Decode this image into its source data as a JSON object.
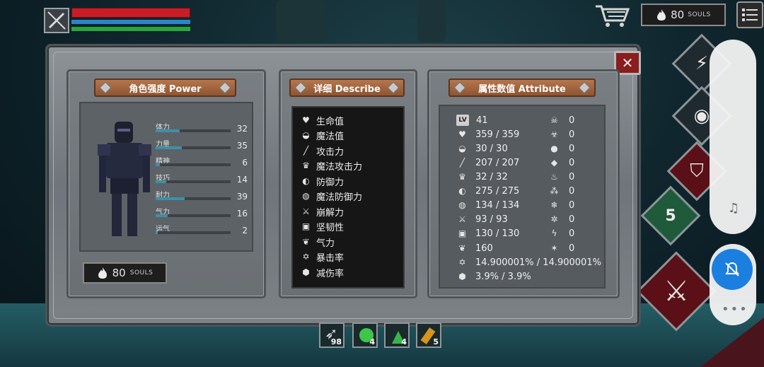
{
  "hud": {
    "souls_count": "80",
    "souls_label": "SOULS"
  },
  "panels": {
    "power": {
      "title": "角色强度 Power",
      "stats": [
        {
          "name": "体力",
          "value": "32",
          "fill": 0.32
        },
        {
          "name": "力量",
          "value": "35",
          "fill": 0.35
        },
        {
          "name": "精神",
          "value": "6",
          "fill": 0.06
        },
        {
          "name": "技巧",
          "value": "14",
          "fill": 0.14
        },
        {
          "name": "耐力",
          "value": "39",
          "fill": 0.39
        },
        {
          "name": "气力",
          "value": "16",
          "fill": 0.16
        },
        {
          "name": "运气",
          "value": "2",
          "fill": 0.02
        }
      ],
      "souls_count": "80",
      "souls_label": "SOULS"
    },
    "describe": {
      "title": "详细 Describe",
      "items": [
        {
          "label": "生命值",
          "icon": "heart-icon"
        },
        {
          "label": "魔法值",
          "icon": "helmet-icon"
        },
        {
          "label": "攻击力",
          "icon": "sword-icon"
        },
        {
          "label": "魔法攻击力",
          "icon": "crown-icon"
        },
        {
          "label": "防御力",
          "icon": "shield-icon"
        },
        {
          "label": "魔法防御力",
          "icon": "magic-shield-icon"
        },
        {
          "label": "崩解力",
          "icon": "crossed-swords-icon"
        },
        {
          "label": "坚韧性",
          "icon": "armor-icon"
        },
        {
          "label": "气力",
          "icon": "lungs-icon"
        },
        {
          "label": "暴击率",
          "icon": "star-icon"
        },
        {
          "label": "减伤率",
          "icon": "guard-icon"
        }
      ]
    },
    "attribute": {
      "title": "属性数值 Attribute",
      "level_badge": "LV",
      "values": [
        "41",
        "359 / 359",
        "30 / 30",
        "207 / 207",
        "32 / 32",
        "275 / 275",
        "134 / 134",
        "93 / 93",
        "130 / 130",
        "160",
        "14.900001% / 14.900001%",
        "3.9% / 3.9%"
      ],
      "resistances": [
        "0",
        "0",
        "0",
        "0",
        "0",
        "0",
        "0",
        "0",
        "0",
        "0"
      ]
    }
  },
  "quick_slots": [
    {
      "name": "arrows",
      "count": "98"
    },
    {
      "name": "green-potion",
      "count": "4"
    },
    {
      "name": "green-flask",
      "count": "4"
    },
    {
      "name": "orange-flask",
      "count": "5"
    }
  ],
  "skills": [
    {
      "name": "skill-5",
      "label": "5"
    }
  ],
  "colors": {
    "hp": "#c81d27",
    "mp": "#2b86c6",
    "stamina": "#2aa53a",
    "ribbon": "#a3663f",
    "bell": "#1b7fe0"
  }
}
